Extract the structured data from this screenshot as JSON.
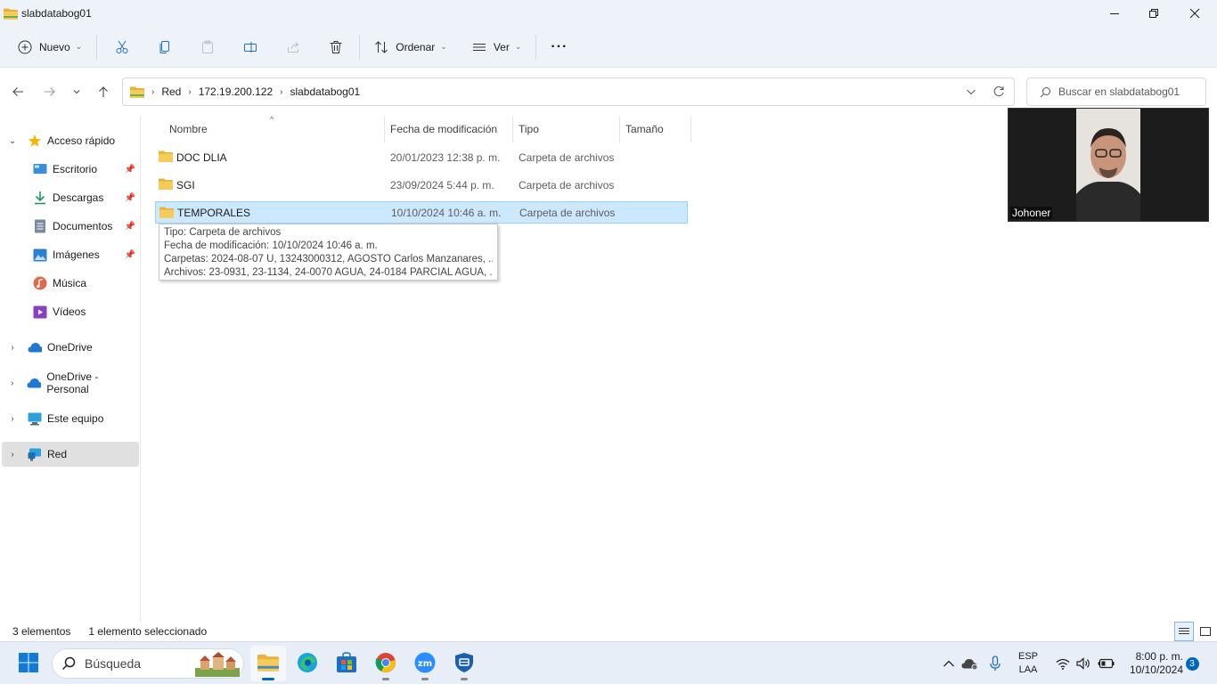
{
  "window": {
    "title": "slabdatabog01"
  },
  "commandbar": {
    "new_label": "Nuevo",
    "sort_label": "Ordenar",
    "view_label": "Ver",
    "more_label": "···"
  },
  "address": {
    "crumbs": [
      "Red",
      "172.19.200.122",
      "slabdatabog01"
    ]
  },
  "search": {
    "placeholder": "Buscar en slabdatabog01"
  },
  "sidebar": {
    "items": [
      {
        "label": "Acceso rápido"
      },
      {
        "label": "Escritorio"
      },
      {
        "label": "Descargas"
      },
      {
        "label": "Documentos"
      },
      {
        "label": "Imágenes"
      },
      {
        "label": "Música"
      },
      {
        "label": "Vídeos"
      },
      {
        "label": "OneDrive"
      },
      {
        "label": "OneDrive - Personal"
      },
      {
        "label": "Este equipo"
      },
      {
        "label": "Red"
      }
    ]
  },
  "columns": {
    "name": "Nombre",
    "modified": "Fecha de modificación",
    "type": "Tipo",
    "size": "Tamaño"
  },
  "files": [
    {
      "name": "DOC DLIA",
      "modified": "20/01/2023 12:38 p. m.",
      "type": "Carpeta de archivos"
    },
    {
      "name": "SGI",
      "modified": "23/09/2024 5:44 p. m.",
      "type": "Carpeta de archivos"
    },
    {
      "name": "TEMPORALES",
      "modified": "10/10/2024 10:46 a. m.",
      "type": "Carpeta de archivos"
    }
  ],
  "tooltip": {
    "type": "Tipo: Carpeta de archivos",
    "modified": "Fecha de modificación: 10/10/2024 10:46 a. m.",
    "folders": "Carpetas: 2024-08-07 U, 13243000312, AGOSTO Carlos Manzanares, ...",
    "files": "Archivos: 23-0931, 23-1134, 24-0070 AGUA, 24-0184 PARCIAL AGUA, ..."
  },
  "video": {
    "name": "Johoner"
  },
  "status": {
    "count": "3 elementos",
    "selected": "1 elemento seleccionado"
  },
  "taskbar": {
    "search_placeholder": "Búsqueda",
    "lang_top": "ESP",
    "lang_bottom": "LAA",
    "time": "8:00 p. m.",
    "date": "10/10/2024",
    "notif_count": "3"
  },
  "colors": {
    "accent": "#0067c0",
    "selection": "#cce8ff",
    "folder": "#f4c74a"
  }
}
